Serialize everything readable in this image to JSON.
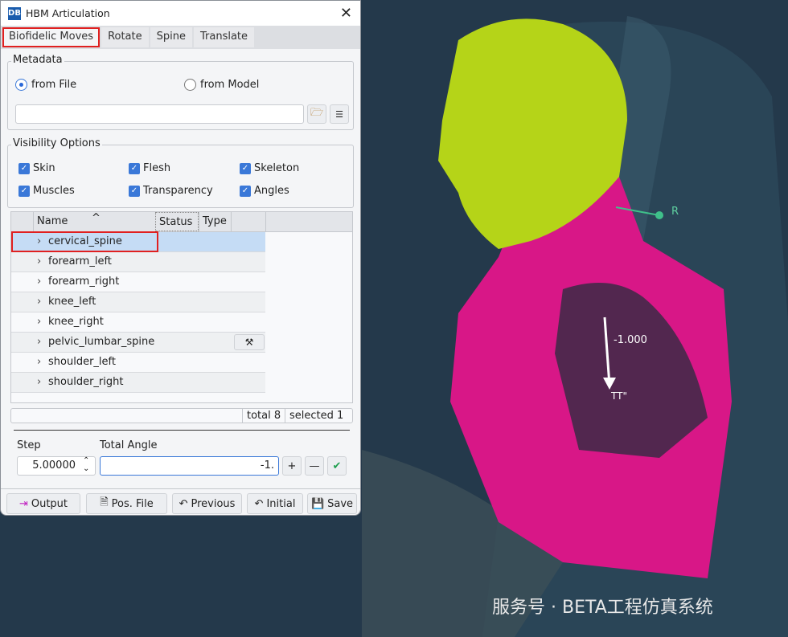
{
  "window": {
    "title": "HBM Articulation",
    "logo": "DB",
    "close": "✕"
  },
  "tabs": [
    {
      "label": "Biofidelic Moves",
      "active": true
    },
    {
      "label": "Rotate"
    },
    {
      "label": "Spine"
    },
    {
      "label": "Translate"
    }
  ],
  "metadata": {
    "label": "Metadata",
    "from_file": "from File",
    "from_model": "from Model",
    "file_value": ""
  },
  "visibility": {
    "label": "Visibility Options",
    "items": [
      "Skin",
      "Flesh",
      "Skeleton",
      "Muscles",
      "Transparency",
      "Angles"
    ]
  },
  "table": {
    "columns": [
      "Name",
      "Status",
      "Type"
    ],
    "sort_indicator": "^",
    "rows": [
      "cervical_spine",
      "forearm_left",
      "forearm_right",
      "knee_left",
      "knee_right",
      "pelvic_lumbar_spine",
      "shoulder_left",
      "shoulder_right"
    ]
  },
  "status": {
    "total": "total 8",
    "selected": "selected 1"
  },
  "step": {
    "label": "Step",
    "value": "5.00000"
  },
  "total_angle": {
    "label": "Total Angle",
    "value": "-1."
  },
  "buttons": {
    "output": "Output",
    "pos_file": "Pos. File",
    "previous": "Previous",
    "initial": "Initial",
    "save": "Save"
  },
  "viewport": {
    "angle_label": "-1.000",
    "axis_label": "R",
    "marker": "TT\"",
    "watermark": "服务号 · BETA工程仿真系统"
  },
  "colors": {
    "accent": "#3a78d8",
    "highlight": "#e02020",
    "head": "#b5d418",
    "torso": "#e0188a"
  }
}
